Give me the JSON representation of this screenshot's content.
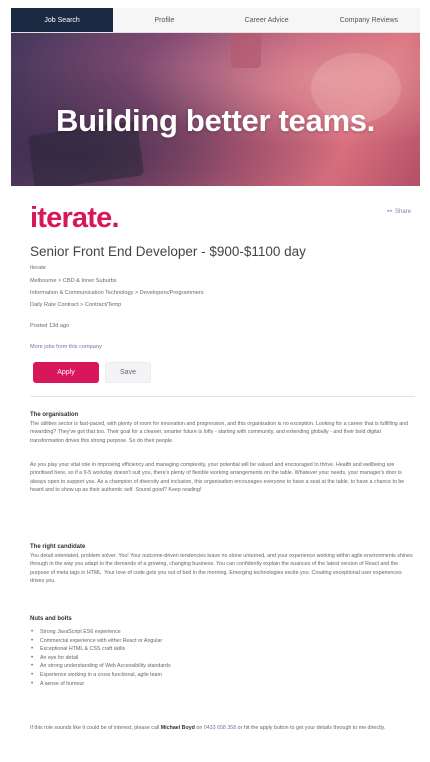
{
  "nav": {
    "tabs": [
      {
        "label": "Job Search",
        "active": true
      },
      {
        "label": "Profile",
        "active": false
      },
      {
        "label": "Career Advice",
        "active": false
      },
      {
        "label": "Company Reviews",
        "active": false
      }
    ]
  },
  "banner": {
    "title": "Building better teams."
  },
  "company": {
    "logo_text": "iterate.",
    "name": "Iterate"
  },
  "share": {
    "label": "Share",
    "icon": "share-icon"
  },
  "job": {
    "title": "Senior Front End Developer - $900-$1100 day",
    "location": "Melbourne  >  CBD & Inner Suburbs",
    "category": "Information & Communication Technology  >  Developers/Programmers",
    "work_type": "Daily Rate Contract  >  Contract/Temp",
    "posted": "Posted 13d ago",
    "more_jobs": "More jobs from this company"
  },
  "actions": {
    "apply": "Apply",
    "save": "Save"
  },
  "description": {
    "org_heading": "The organisation",
    "org_p1": "The utilities sector is fast-paced, with plenty of room for innovation and progression, and this organisation is no exception. Looking for a career that is fulfilling and rewarding? They've got that too. Their goal for a cleaner, smarter future is lofty - starting with community, and extending globally - and their bold digital transformation drives this strong purpose. So do their people.",
    "org_p2": "As you play your vital role in improving efficiency and managing complexity, your potential will be valued and encouraged to thrive. Health and wellbeing are prioritised here, so if a 9-5 workday doesn't suit you, there's plenty of flexible working arrangements on the table. Whatever your needs, your manager's door is always open to support you. As a champion of diversity and inclusion, this organisation encourages everyone to have a seat at the table, to have a chance to be heard and to show up as their authentic self. Sound good? Keep reading!",
    "candidate_heading": "The right candidate",
    "candidate_p": "You detail orientated, problem solver. You! Your outcome-driven tendencies leave no stone unturned, and your experience working within agile environments shines through in the way you adapt to the demands of a growing, changing business. You can confidently explain the nuances of the latest version of React and the purpose of meta tags in HTML. Your love of code gets you out of bed in the morning. Emerging technologies excite you. Creating exceptional user experiences drives you.",
    "nuts_heading": "Nuts and bolts",
    "bullets": [
      "Strong JavaScript ES6 experience",
      "Commercial experience with either React or Angular",
      "Exceptional HTML & CSS craft skills",
      "An eye for detail",
      "An strong understanding of Web Accessibility standards",
      "Experience working in a cross functional, agile team",
      "A sense of humour"
    ],
    "closing_pre": "If this role sounds like it could be of interest, please call",
    "contact_name": "Michael Boyd",
    "closing_on": "on",
    "phone": "0433 658 358",
    "closing_post": "or hit the apply button to get your details through to me directly."
  }
}
